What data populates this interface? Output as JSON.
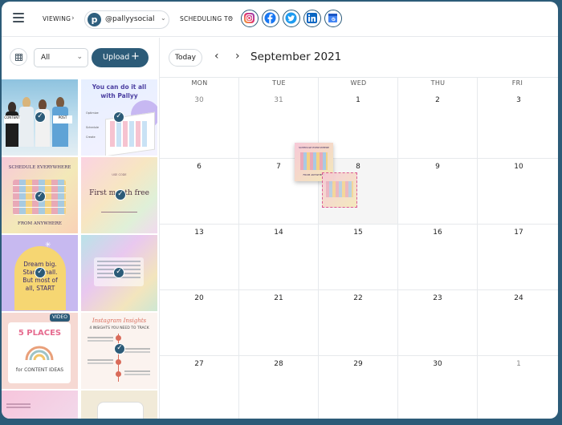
{
  "topbar": {
    "viewing_label": "VIEWING",
    "account": "@pallyysocial",
    "account_logo_letter": "p",
    "scheduling_label": "SCHEDULING TO",
    "networks": [
      "instagram-icon",
      "facebook-icon",
      "twitter-icon",
      "linkedin-icon",
      "google-business-icon"
    ]
  },
  "sidebar": {
    "filter_value": "All",
    "upload_label": "Upload",
    "upload_icon": "+",
    "thumbs": [
      {
        "name": "thumb-people-photo"
      },
      {
        "name": "thumb-do-it-all",
        "title": "You can do it all",
        "subtitle": "with Pallyy"
      },
      {
        "name": "thumb-schedule-everywhere",
        "top": "SCHEDULE EVERYWHERE",
        "bottom": "FROM ANYWHERE"
      },
      {
        "name": "thumb-first-month-free",
        "text": "First month free"
      },
      {
        "name": "thumb-dream-big",
        "text": "Dream big. Start small. But most of all, START"
      },
      {
        "name": "thumb-quote-pastel"
      },
      {
        "name": "thumb-5-places",
        "badge": "VIDEO",
        "big": "5 PLACES",
        "small": "for CONTENT IDEAS"
      },
      {
        "name": "thumb-insights",
        "title": "Instagram Insights",
        "subtitle": "4 INSIGHTS YOU NEED TO TRACK"
      },
      {
        "name": "thumb-bottom-left"
      },
      {
        "name": "thumb-bottom-right"
      }
    ]
  },
  "calendar": {
    "today_label": "Today",
    "month_title": "September 2021",
    "prev_icon": "chevron-left-icon",
    "next_icon": "chevron-right-icon",
    "days": [
      "MON",
      "TUE",
      "WED",
      "THU",
      "FRI"
    ],
    "weeks": [
      [
        {
          "n": "30",
          "muted": true
        },
        {
          "n": "31",
          "muted": true
        },
        {
          "n": "1"
        },
        {
          "n": "2"
        },
        {
          "n": "3"
        }
      ],
      [
        {
          "n": "6"
        },
        {
          "n": "7"
        },
        {
          "n": "8"
        },
        {
          "n": "9"
        },
        {
          "n": "10"
        }
      ],
      [
        {
          "n": "13"
        },
        {
          "n": "14"
        },
        {
          "n": "15"
        },
        {
          "n": "16"
        },
        {
          "n": "17"
        }
      ],
      [
        {
          "n": "20"
        },
        {
          "n": "21"
        },
        {
          "n": "22"
        },
        {
          "n": "23"
        },
        {
          "n": "24"
        }
      ],
      [
        {
          "n": "27"
        },
        {
          "n": "28"
        },
        {
          "n": "29"
        },
        {
          "n": "30"
        },
        {
          "n": "1",
          "muted": true
        }
      ]
    ]
  },
  "colors": {
    "brand": "#2c5b78",
    "border": "#e6e9ec"
  }
}
